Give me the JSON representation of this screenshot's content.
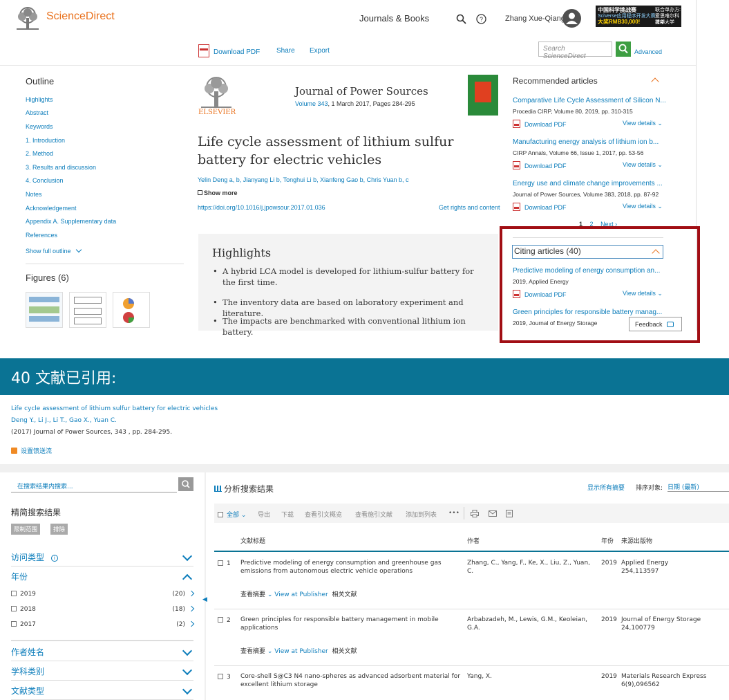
{
  "header": {
    "brand": "ScienceDirect",
    "nav_journals": "Journals & Books",
    "user_name": "Zhang Xue-Qiang",
    "banner_line1": "中国科学挑战赛",
    "banner_line2": "SciVerse应用程序开发大赛",
    "banner_line3": "大奖RMB30,000!",
    "banner_line4": "联合单办方:",
    "banner_line5": "爱思唯尔科技部",
    "banner_line6": "清华大学"
  },
  "toolbar": {
    "download_pdf": "Download PDF",
    "share": "Share",
    "export": "Export",
    "search_placeholder": "Search ScienceDirect",
    "advanced": "Advanced"
  },
  "outline": {
    "title": "Outline",
    "items": [
      "Highlights",
      "Abstract",
      "Keywords",
      "1. Introduction",
      "2. Method",
      "3. Results and discussion",
      "4. Conclusion",
      "Notes",
      "Acknowledgement",
      "Appendix A. Supplementary data",
      "References"
    ],
    "show_full": "Show full outline",
    "figures_title": "Figures (6)"
  },
  "article": {
    "publisher": "ELSEVIER",
    "journal": "Journal of Power Sources",
    "volume_link": "Volume 343",
    "volume_rest": ", 1 March 2017, Pages 284-295",
    "title": "Life cycle assessment of lithium sulfur battery for electric vehicles",
    "authors": "Yelin Deng a, b, Jianyang Li b, Tonghui Li b, Xianfeng Gao b, Chris Yuan b, c",
    "show_more": "Show more",
    "doi": "https://doi.org/10.1016/j.jpowsour.2017.01.036",
    "rights": "Get rights and content",
    "highlights_title": "Highlights",
    "highlights": [
      "A hybrid LCA model is developed for lithium-sulfur battery for the first time.",
      "The inventory data are based on laboratory experiment and literature.",
      "The impacts are benchmarked with conventional lithium ion battery."
    ]
  },
  "recommended": {
    "title": "Recommended articles",
    "items": [
      {
        "title": "Comparative Life Cycle Assessment of Silicon N...",
        "source": "Procedia CIRP, Volume 80, 2019, pp. 310-315"
      },
      {
        "title": "Manufacturing energy analysis of lithium ion b...",
        "source": "CIRP Annals, Volume 66, Issue 1, 2017, pp. 53-56"
      },
      {
        "title": "Energy use and climate change improvements ...",
        "source": "Journal of Power Sources, Volume 383, 2018, pp. 87-92"
      }
    ],
    "download_pdf": "Download PDF",
    "view_details": "View details",
    "page1": "1",
    "page2": "2",
    "next": "Next"
  },
  "citing": {
    "title": "Citing articles (40)",
    "items": [
      {
        "title": "Predictive modeling of energy consumption an...",
        "source": "2019, Applied Energy"
      },
      {
        "title": "Green principles for responsible battery manag...",
        "source": "2019, Journal of Energy Storage"
      }
    ],
    "feedback": "Feedback"
  },
  "scopus": {
    "header": "40 文献已引用:",
    "ref_title": "Life cycle assessment of lithium sulfur battery for electric vehicles",
    "ref_authors": "Deng Y., Li J., Li T., Gao X., Yuan C.",
    "ref_source": "(2017) Journal of Power Sources, 343 , pp. 284-295.",
    "alert": "设置馈送流",
    "search_within": "在搜索结果内搜索...",
    "refine": "精简搜索结果",
    "limit_btn": "限制范围",
    "exclude_btn": "排除",
    "facet_access": "访问类型",
    "facet_year": "年份",
    "years": [
      {
        "year": "2019",
        "count": "(20)"
      },
      {
        "year": "2018",
        "count": "(18)"
      },
      {
        "year": "2017",
        "count": "(2)"
      }
    ],
    "facet_author": "作者姓名",
    "facet_subject": "学科类别",
    "facet_doctype": "文献类型",
    "analyze": "分析搜索结果",
    "show_all_abstracts": "显示所有摘要",
    "sort_label": "排序对象:",
    "sort_value": "日期 (最新)",
    "select_all": "全部",
    "actions": [
      "导出",
      "下载",
      "查看引文概览",
      "查看施引文献",
      "添加到列表",
      "•••"
    ],
    "col_title": "文献标题",
    "col_author": "作者",
    "col_year": "年份",
    "col_source": "来源出版物",
    "view_abstract": "查看摘要",
    "view_publisher": "View at Publisher",
    "related": "相关文献",
    "rows": [
      {
        "n": "1",
        "title": "Predictive modeling of energy consumption and greenhouse gas emissions from autonomous electric vehicle operations",
        "authors": "Zhang, C., Yang, F., Ke, X., Liu, Z., Yuan, C.",
        "year": "2019",
        "src1": "Applied Energy",
        "src2": "254,113597"
      },
      {
        "n": "2",
        "title": "Green principles for responsible battery management in mobile applications",
        "authors": "Arbabzadeh, M., Lewis, G.M., Keoleian, G.A.",
        "year": "2019",
        "src1": "Journal of Energy Storage",
        "src2": "24,100779"
      },
      {
        "n": "3",
        "title": "Core-shell S@C3 N4 nano-spheres as advanced adsorbent material for excellent lithium storage",
        "authors": "Yang, X.",
        "year": "2019",
        "src1": "Materials Research Express",
        "src2": "6(9),096562"
      }
    ]
  },
  "colors": {
    "accent_orange": "#e9711c",
    "link_blue": "#0c7dbb",
    "teal_header": "#0a7394",
    "highlight_red": "#a10e14"
  }
}
